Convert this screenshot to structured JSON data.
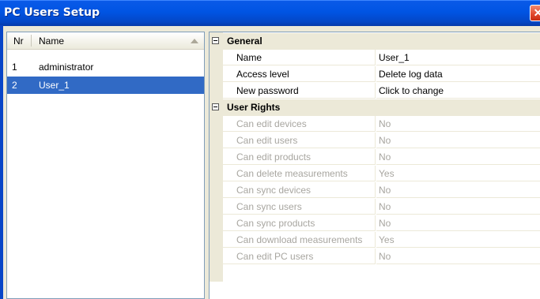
{
  "window": {
    "title": "PC Users Setup",
    "close_glyph": "✕"
  },
  "users_list": {
    "columns": [
      "Nr",
      "Name"
    ],
    "rows": [
      {
        "nr": "1",
        "name": "administrator"
      },
      {
        "nr": "2",
        "name": "User_1"
      }
    ],
    "selected_index": 1
  },
  "properties": {
    "categories": [
      {
        "label": "General",
        "items": [
          {
            "name": "Name",
            "value": "User_1"
          },
          {
            "name": "Access level",
            "value": "Delete log data"
          },
          {
            "name": "New password",
            "value": "Click to change"
          }
        ]
      },
      {
        "label": "User Rights",
        "items": [
          {
            "name": "Can edit devices",
            "value": "No"
          },
          {
            "name": "Can edit users",
            "value": "No"
          },
          {
            "name": "Can edit products",
            "value": "No"
          },
          {
            "name": "Can delete measurements",
            "value": "Yes"
          },
          {
            "name": "Can sync devices",
            "value": "No"
          },
          {
            "name": "Can sync users",
            "value": "No"
          },
          {
            "name": "Can sync products",
            "value": "No"
          },
          {
            "name": "Can download measurements",
            "value": "Yes"
          },
          {
            "name": "Can edit PC users",
            "value": "No"
          }
        ]
      }
    ]
  },
  "colors": {
    "title_bar": "#0054e3",
    "selection": "#316ac5",
    "disabled_text": "#a8a6a0"
  }
}
